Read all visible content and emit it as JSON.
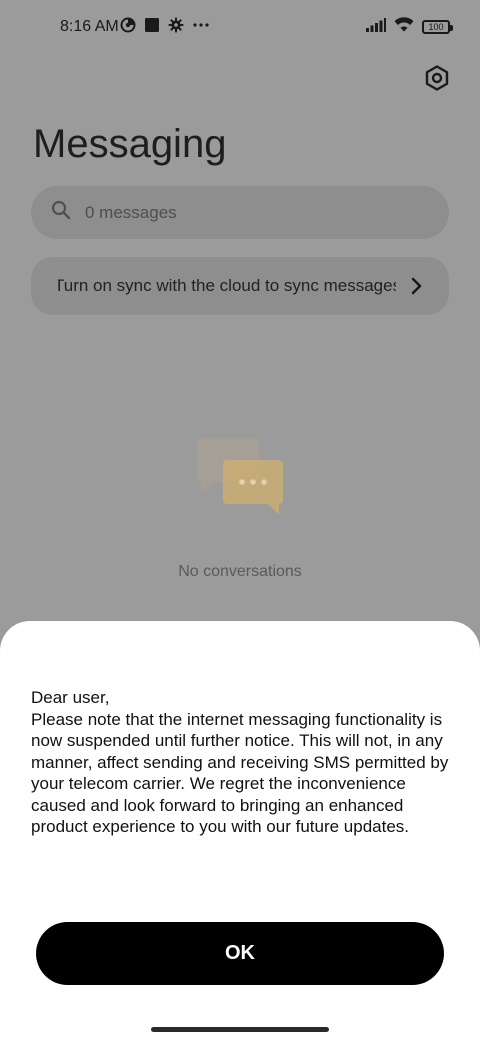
{
  "status_bar": {
    "time": "8:16 AM",
    "battery": "100",
    "icons_left": [
      "data-saver-icon",
      "square-notification-icon",
      "gear-icon",
      "more-dots-icon"
    ],
    "icons_right": [
      "signal-icon",
      "wifi-icon",
      "battery-icon"
    ]
  },
  "header": {
    "title": "Messaging",
    "settings_icon": "settings-hexagon-icon"
  },
  "search": {
    "placeholder": "0 messages",
    "icon": "search-icon"
  },
  "sync_banner": {
    "text": "Turn on sync with the cloud to sync messages",
    "icon": "chevron-right-icon"
  },
  "empty_state": {
    "text": "No conversations",
    "icon": "chat-bubbles-icon"
  },
  "dialog": {
    "message": "Dear user,\nPlease note that the internet messaging functionality is now suspended until further notice. This will not, in any manner, affect sending and receiving SMS permitted by your telecom carrier. We regret the inconvenience caused and look forward to bringing an enhanced product experience to you with our future updates.",
    "ok_label": "OK"
  },
  "colors": {
    "scrim_background": "#9b9b9b",
    "field_background": "#8e8e8e",
    "dialog_background": "#ffffff",
    "button_background": "#000000",
    "illustration_accent": "#c9ad73"
  }
}
